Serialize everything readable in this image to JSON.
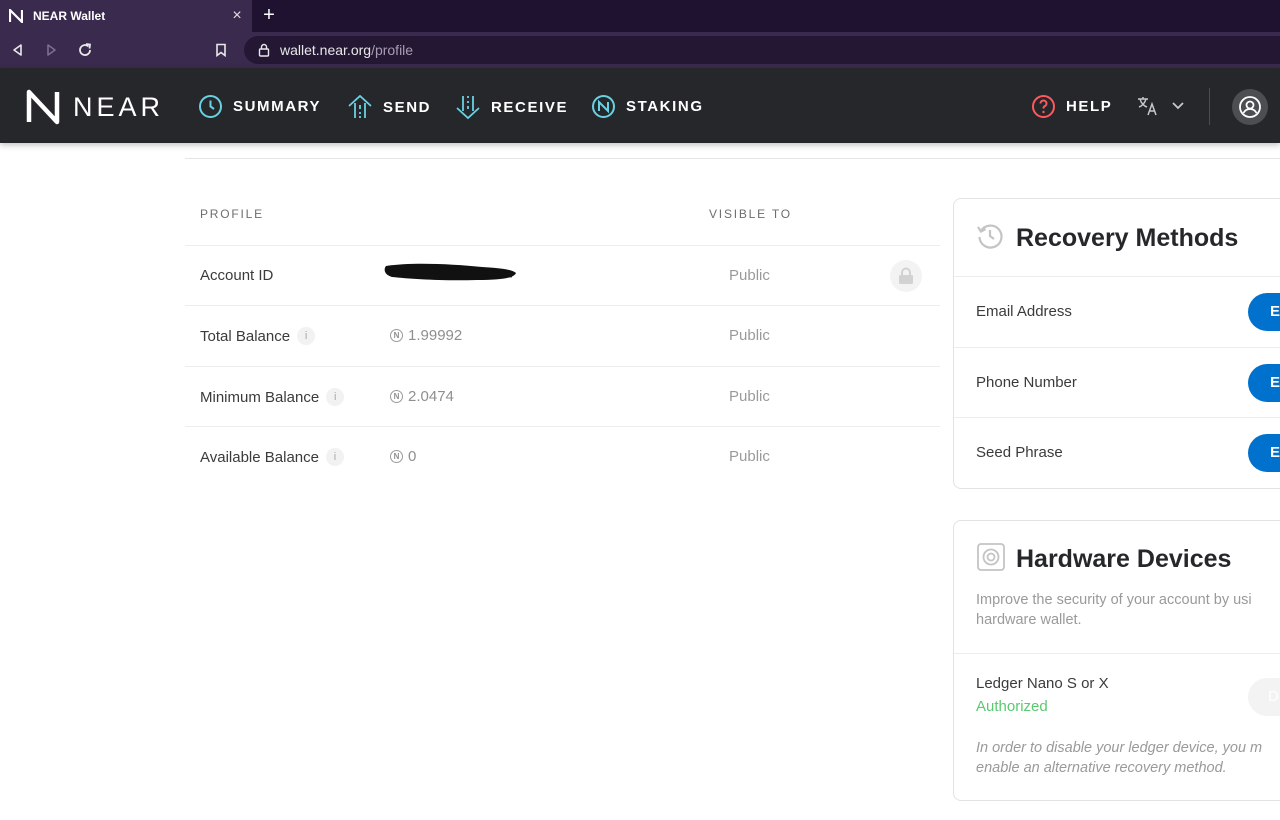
{
  "browser": {
    "tab_title": "NEAR Wallet",
    "tab_close": "×",
    "new_tab": "+",
    "url_host": "wallet.near.org",
    "url_path": "/profile"
  },
  "header": {
    "logo_text": "NEAR",
    "nav": [
      {
        "label": "SUMMARY",
        "icon": "clock-icon"
      },
      {
        "label": "SEND",
        "icon": "send-arrow-icon"
      },
      {
        "label": "RECEIVE",
        "icon": "receive-arrow-icon"
      },
      {
        "label": "STAKING",
        "icon": "near-staking-icon"
      }
    ],
    "help_label": "HELP",
    "colors": {
      "accent": "#6ad1e3",
      "help": "#ff585d",
      "background": "#25272a"
    }
  },
  "profile": {
    "col_profile": "PROFILE",
    "col_visible": "VISIBLE TO",
    "rows": [
      {
        "label": "Account ID",
        "value": "",
        "visibility": "Public"
      },
      {
        "label": "Total Balance",
        "value": "1.99992",
        "visibility": "Public"
      },
      {
        "label": "Minimum Balance",
        "value": "2.0474",
        "visibility": "Public"
      },
      {
        "label": "Available Balance",
        "value": "0",
        "visibility": "Public"
      }
    ],
    "info_glyph": "i",
    "near_glyph": "N"
  },
  "recovery": {
    "title": "Recovery Methods",
    "rows": [
      {
        "label": "Email Address",
        "button": "E"
      },
      {
        "label": "Phone Number",
        "button": "E"
      },
      {
        "label": "Seed Phrase",
        "button": "E"
      }
    ]
  },
  "hardware": {
    "title": "Hardware Devices",
    "description": "Improve the security of your account by usi hardware wallet.",
    "device_name": "Ledger Nano S or X",
    "device_status": "Authorized",
    "button": "D",
    "note": "In order to disable your ledger device, you m enable an alternative recovery method.",
    "colors": {
      "authorized": "#5ac96f",
      "button": "#0072ce"
    }
  }
}
